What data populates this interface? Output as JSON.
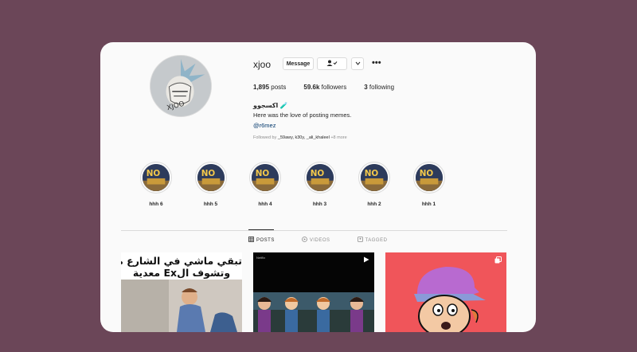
{
  "profile": {
    "username": "xjoo",
    "buttons": {
      "message": "Message",
      "follow_icon": "person-check-icon",
      "dropdown_icon": "chevron-down-icon",
      "more": "•••"
    },
    "stats": [
      {
        "value": "1,895",
        "label": "posts"
      },
      {
        "value": "59.6k",
        "label": "followers"
      },
      {
        "value": "3",
        "label": "following"
      }
    ],
    "full_name": "اكسجوو 🧪",
    "bio": "Here was the love of posting memes.",
    "link": "@r6mez",
    "followed_by_prefix": "Followed by ",
    "followed_by_names": "_59awy, k30y, _ali_khaleel",
    "followed_by_more": " +8 more"
  },
  "highlights": [
    {
      "label": "hhh 6"
    },
    {
      "label": "hhh 5"
    },
    {
      "label": "hhh 4"
    },
    {
      "label": "hhh 3"
    },
    {
      "label": "hhh 2"
    },
    {
      "label": "hhh 1"
    }
  ],
  "tabs": [
    {
      "label": "POSTS",
      "icon": "grid-icon",
      "active": true
    },
    {
      "label": "VIDEOS",
      "icon": "play-circle-icon",
      "active": false
    },
    {
      "label": "TAGGED",
      "icon": "tag-icon",
      "active": false
    }
  ],
  "posts": [
    {
      "caption_line1": "تبقي ماشي في الشارع مع الكر",
      "caption_line2": "وتشوف الEx معدية"
    },
    {
      "watermark": "Netflix",
      "type_icon": "video-icon"
    },
    {
      "type_icon": "multi-post-icon"
    }
  ],
  "colors": {
    "background": "#6b4658",
    "card": "#fafafa",
    "link": "#00376b",
    "post3_bg": "#f0555a"
  }
}
